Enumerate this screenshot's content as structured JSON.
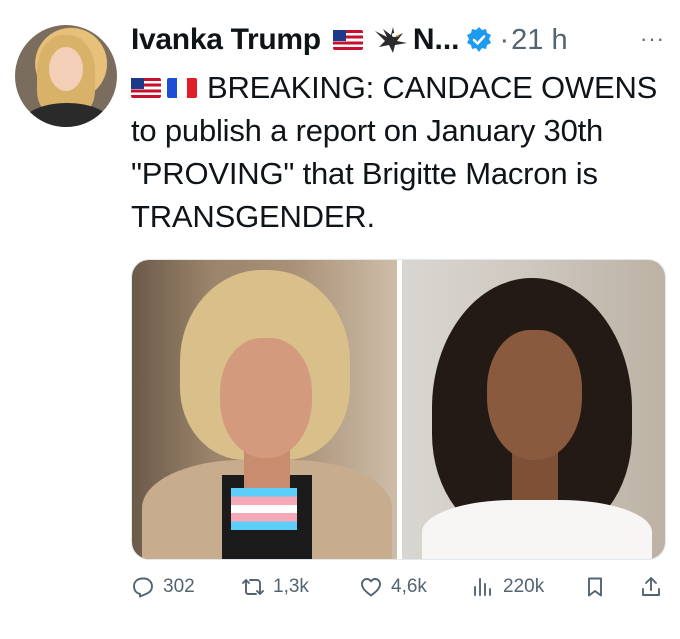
{
  "author": {
    "display_name": "Ivanka Trump",
    "name_suffix": "N...",
    "time": "21 h",
    "separator": "·",
    "more": "···"
  },
  "icons": {
    "flag_1": "us-flag-icon",
    "flag_2": "fr-flag-icon",
    "eagle": "eagle-icon",
    "verified": "verified-badge-icon"
  },
  "tweet": {
    "text": "BREAKING: CANDACE OWENS to publish a report on January 30th \"PROVING\" that Brigitte Macron is TRANSGENDER."
  },
  "stats": {
    "replies": "302",
    "retweets": "1,3k",
    "likes": "4,6k",
    "views": "220k"
  },
  "colors": {
    "text": "#0f1419",
    "secondary": "#536471",
    "verified": "#1d9bf0"
  }
}
